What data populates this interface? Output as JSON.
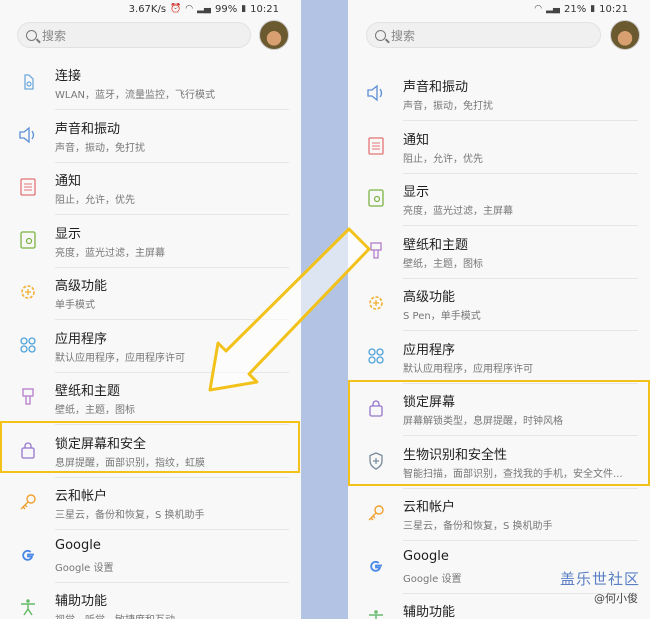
{
  "left": {
    "status": {
      "speed": "3.67K/s",
      "battery": "99%",
      "time": "10:21"
    },
    "search_placeholder": "搜索",
    "items": [
      {
        "title": "连接",
        "sub": "WLAN，蓝牙，流量监控，飞行模式",
        "icon": "link-icon"
      },
      {
        "title": "声音和振动",
        "sub": "声音，振动，免打扰",
        "icon": "speaker-icon"
      },
      {
        "title": "通知",
        "sub": "阻止，允许，优先",
        "icon": "notification-icon"
      },
      {
        "title": "显示",
        "sub": "亮度，蓝光过滤，主屏幕",
        "icon": "display-icon"
      },
      {
        "title": "高级功能",
        "sub": "单手模式",
        "icon": "gear-plus-icon"
      },
      {
        "title": "应用程序",
        "sub": "默认应用程序，应用程序许可",
        "icon": "apps-icon"
      },
      {
        "title": "壁纸和主题",
        "sub": "壁纸，主题，图标",
        "icon": "brush-icon"
      },
      {
        "title": "锁定屏幕和安全",
        "sub": "息屏提醒，面部识别，指纹，虹膜",
        "icon": "lock-icon"
      },
      {
        "title": "云和帐户",
        "sub": "三星云，备份和恢复，S 换机助手",
        "icon": "key-icon"
      },
      {
        "title": "Google",
        "sub": "Google 设置",
        "icon": "google-icon"
      },
      {
        "title": "辅助功能",
        "sub": "视觉，听觉，敏捷度和互动",
        "icon": "accessibility-icon"
      }
    ]
  },
  "right": {
    "status": {
      "battery": "21%",
      "time": "10:21"
    },
    "search_placeholder": "搜索",
    "items": [
      {
        "title": "声音和振动",
        "sub": "声音，振动，免打扰",
        "icon": "speaker-icon"
      },
      {
        "title": "通知",
        "sub": "阻止，允许，优先",
        "icon": "notification-icon"
      },
      {
        "title": "显示",
        "sub": "亮度，蓝光过滤，主屏幕",
        "icon": "display-icon"
      },
      {
        "title": "壁纸和主题",
        "sub": "壁纸，主题，图标",
        "icon": "brush-icon"
      },
      {
        "title": "高级功能",
        "sub": "S Pen，单手模式",
        "icon": "gear-plus-icon"
      },
      {
        "title": "应用程序",
        "sub": "默认应用程序，应用程序许可",
        "icon": "apps-icon"
      },
      {
        "title": "锁定屏幕",
        "sub": "屏幕解锁类型，息屏提醒，时钟风格",
        "icon": "lock-icon"
      },
      {
        "title": "生物识别和安全性",
        "sub": "智能扫描，面部识别，查找我的手机，安全文件...",
        "icon": "shield-icon"
      },
      {
        "title": "云和帐户",
        "sub": "三星云，备份和恢复，S 换机助手",
        "icon": "key-icon"
      },
      {
        "title": "Google",
        "sub": "Google 设置",
        "icon": "google-icon"
      },
      {
        "title": "辅助功能",
        "sub": "",
        "icon": "accessibility-icon"
      }
    ]
  },
  "watermark": {
    "brand": "盖乐世社区",
    "user": "@何小俊"
  },
  "colors": {
    "highlight": "#f2c21b",
    "divider_bar": "#b3c3e3"
  }
}
